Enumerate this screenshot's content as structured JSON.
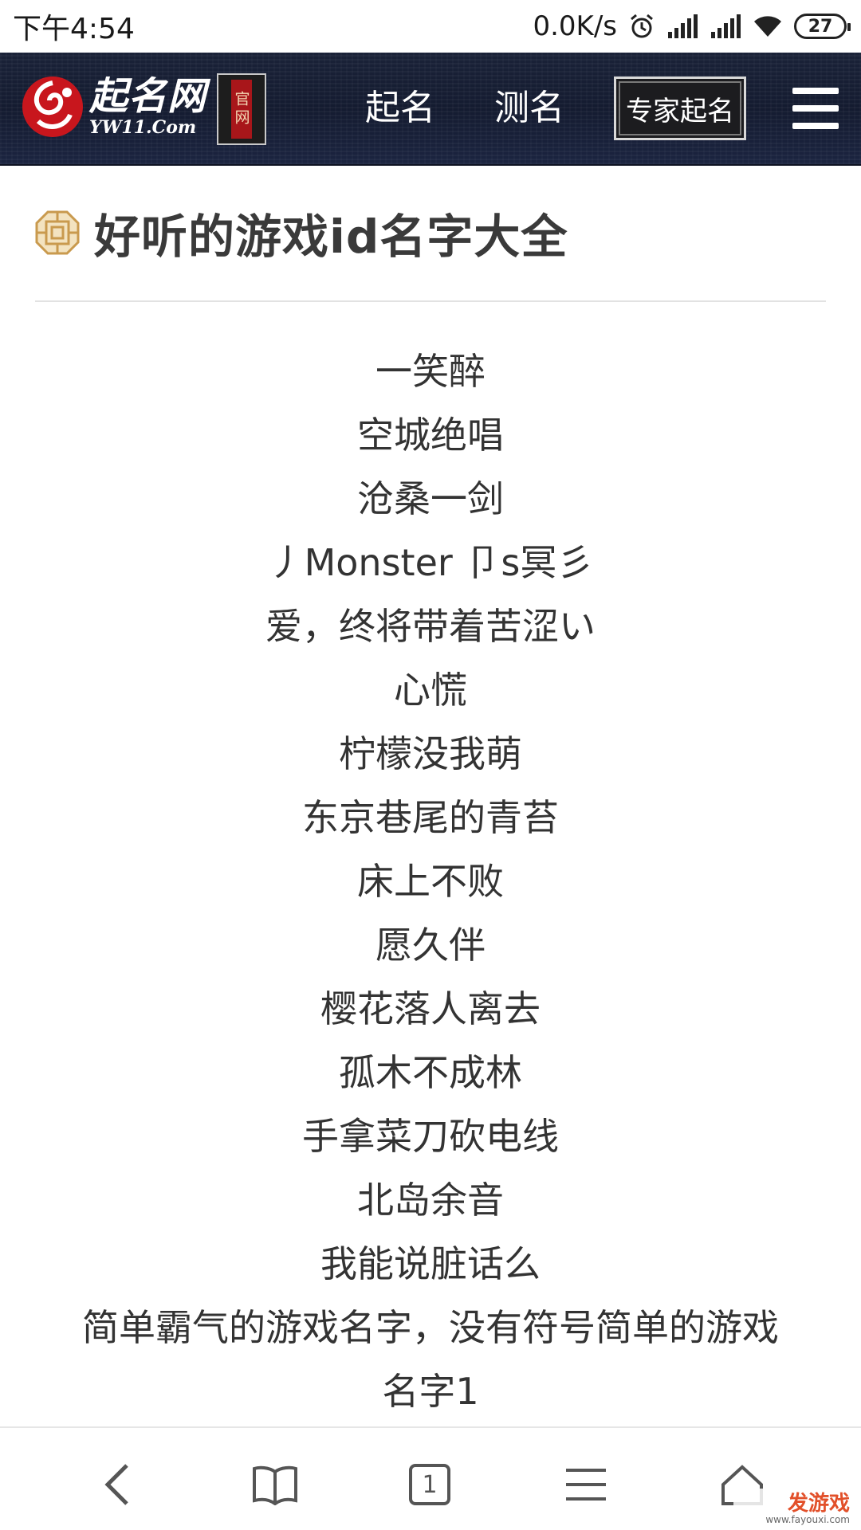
{
  "status_bar": {
    "time": "下午4:54",
    "net_speed": "0.0K/s",
    "battery": "27",
    "icons": [
      "alarm-icon",
      "signal-icon",
      "signal-icon",
      "wifi-icon",
      "battery-icon"
    ]
  },
  "header": {
    "logo_name": "起名网",
    "logo_domain": "YW11.Com",
    "seal_text": "官网",
    "nav": {
      "qiming": "起名",
      "ceming": "测名",
      "expert": "专家起名"
    },
    "background_color": "#1a2238"
  },
  "article": {
    "title": "好听的游戏id名字大全",
    "names": [
      "一笑醉",
      "空城绝唱",
      "沧桑一剑",
      "丿Monster 卩s冥彡",
      "爱，终将带着苦涩い",
      "心慌",
      "柠檬没我萌",
      "东京巷尾的青苔",
      "床上不败",
      "愿久伴",
      "樱花落人离去",
      "孤木不成林",
      "手拿菜刀砍电线",
      "北岛余音",
      "我能说脏话么"
    ],
    "sub_heading_line1": "简单霸气的游戏名字，没有符号简单的游戏",
    "sub_heading_line2": "名字1"
  },
  "bottom_bar": {
    "tab_count": "1",
    "icons": [
      "back-icon",
      "bookmarks-icon",
      "tabs-icon",
      "menu-icon",
      "home-icon"
    ]
  },
  "watermark": {
    "main": "发游戏",
    "url": "www.fayouxi.com"
  }
}
